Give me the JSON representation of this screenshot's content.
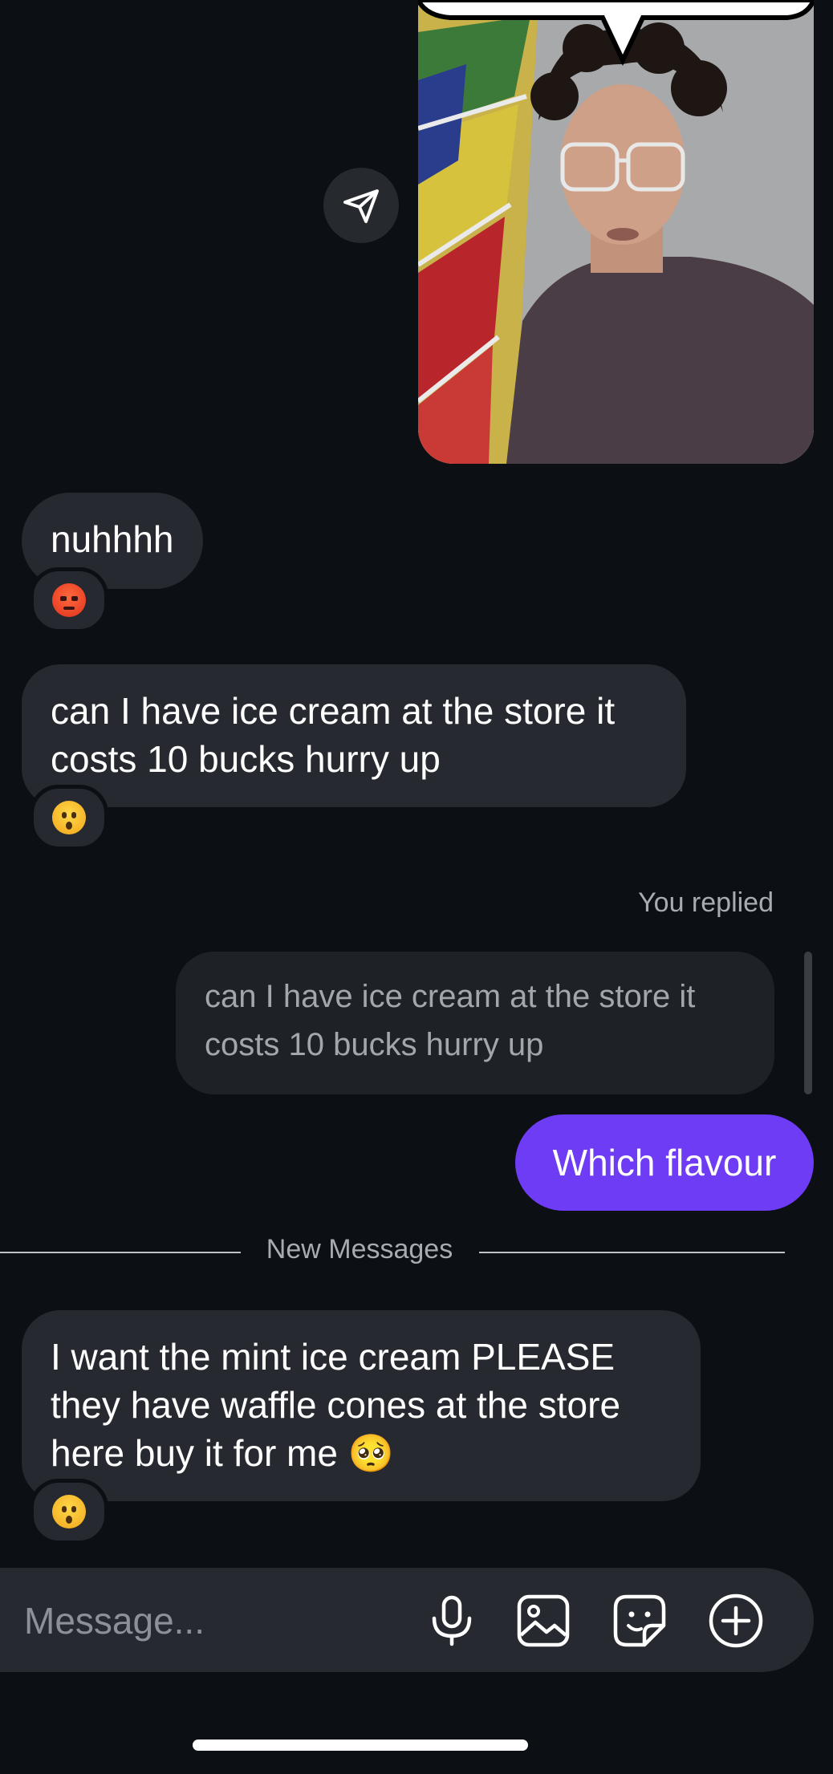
{
  "shared_post": {
    "image": "selfie-in-grocery-aisle-photo",
    "share_icon": "paper-plane-icon"
  },
  "messages": [
    {
      "text": "nuhhhh",
      "reaction": "angry-face-emoji"
    },
    {
      "text": "can I have ice cream at the store it costs 10 bucks hurry up",
      "reaction": "hushed-face-emoji"
    }
  ],
  "reply": {
    "label": "You replied",
    "quoted_text": "can I have ice cream at the store it costs 10 bucks hurry up",
    "sent_text": "Which flavour"
  },
  "divider": {
    "label": "New Messages"
  },
  "new_message": {
    "text": "I want the mint ice cream PLEASE they have waffle cones at the store here buy it for me 🥺",
    "reaction": "hushed-face-emoji"
  },
  "composer": {
    "placeholder": "Message...",
    "icons": [
      "microphone-icon",
      "image-icon",
      "sticker-icon",
      "plus-circle-icon"
    ]
  },
  "colors": {
    "background": "#0c1014",
    "bubble": "#262a30",
    "sent_bubble": "#6f3cf5"
  }
}
